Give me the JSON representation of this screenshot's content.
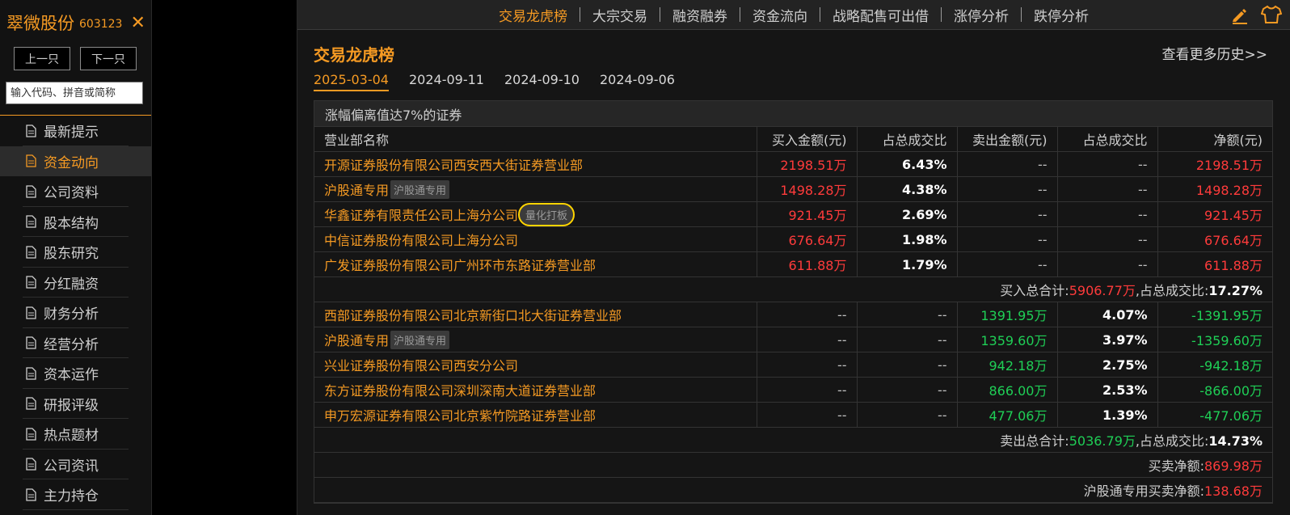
{
  "sidebar": {
    "stock_name": "翠微股份",
    "stock_code": "603123",
    "close_symbol": "✕",
    "prev_label": "上一只",
    "next_label": "下一只",
    "search_placeholder": "输入代码、拼音或简称",
    "items": [
      {
        "label": "最新提示",
        "active": false
      },
      {
        "label": "资金动向",
        "active": true
      },
      {
        "label": "公司资料",
        "active": false
      },
      {
        "label": "股本结构",
        "active": false
      },
      {
        "label": "股东研究",
        "active": false
      },
      {
        "label": "分红融资",
        "active": false
      },
      {
        "label": "财务分析",
        "active": false
      },
      {
        "label": "经营分析",
        "active": false
      },
      {
        "label": "资本运作",
        "active": false
      },
      {
        "label": "研报评级",
        "active": false
      },
      {
        "label": "热点题材",
        "active": false
      },
      {
        "label": "公司资讯",
        "active": false
      },
      {
        "label": "主力持仓",
        "active": false
      }
    ]
  },
  "topnav": {
    "tabs": [
      {
        "label": "交易龙虎榜",
        "active": true
      },
      {
        "label": "大宗交易",
        "active": false
      },
      {
        "label": "融资融券",
        "active": false
      },
      {
        "label": "资金流向",
        "active": false
      },
      {
        "label": "战略配售可出借",
        "active": false
      },
      {
        "label": "涨停分析",
        "active": false
      },
      {
        "label": "跌停分析",
        "active": false
      }
    ],
    "tools": [
      "edit-icon",
      "skin-shirt-icon"
    ]
  },
  "main": {
    "title": "交易龙虎榜",
    "more_link": "查看更多历史>>",
    "dates": [
      {
        "label": "2025-03-04",
        "active": true
      },
      {
        "label": "2024-09-11",
        "active": false
      },
      {
        "label": "2024-09-10",
        "active": false
      },
      {
        "label": "2024-09-06",
        "active": false
      }
    ]
  },
  "table": {
    "caption": "涨幅偏离值达7%的证券",
    "headers": [
      "营业部名称",
      "买入金额(元)",
      "占总成交比",
      "卖出金额(元)",
      "占总成交比",
      "净额(元)"
    ],
    "buy_rows": [
      {
        "name": "开源证券股份有限公司西安西大街证券营业部",
        "tag": "",
        "buy": "2198.51万",
        "buy_pct": "6.43%",
        "sell": "--",
        "sell_pct": "--",
        "net": "2198.51万"
      },
      {
        "name": "沪股通专用",
        "tag": "沪股通专用",
        "buy": "1498.28万",
        "buy_pct": "4.38%",
        "sell": "--",
        "sell_pct": "--",
        "net": "1498.28万"
      },
      {
        "name": "华鑫证券有限责任公司上海分公司",
        "tag": "量化打板",
        "buy": "921.45万",
        "buy_pct": "2.69%",
        "sell": "--",
        "sell_pct": "--",
        "net": "921.45万"
      },
      {
        "name": "中信证券股份有限公司上海分公司",
        "tag": "",
        "buy": "676.64万",
        "buy_pct": "1.98%",
        "sell": "--",
        "sell_pct": "--",
        "net": "676.64万"
      },
      {
        "name": "广发证券股份有限公司广州环市东路证券营业部",
        "tag": "",
        "buy": "611.88万",
        "buy_pct": "1.79%",
        "sell": "--",
        "sell_pct": "--",
        "net": "611.88万"
      }
    ],
    "buy_total": {
      "label1": "买入总合计:",
      "amount": "5906.77万",
      "label2": ",占总成交比:",
      "pct": "17.27%"
    },
    "sell_rows": [
      {
        "name": "西部证券股份有限公司北京新街口北大街证券营业部",
        "tag": "",
        "buy": "--",
        "buy_pct": "--",
        "sell": "1391.95万",
        "sell_pct": "4.07%",
        "net": "-1391.95万"
      },
      {
        "name": "沪股通专用",
        "tag": "沪股通专用",
        "buy": "--",
        "buy_pct": "--",
        "sell": "1359.60万",
        "sell_pct": "3.97%",
        "net": "-1359.60万"
      },
      {
        "name": "兴业证券股份有限公司西安分公司",
        "tag": "",
        "buy": "--",
        "buy_pct": "--",
        "sell": "942.18万",
        "sell_pct": "2.75%",
        "net": "-942.18万"
      },
      {
        "name": "东方证券股份有限公司深圳深南大道证券营业部",
        "tag": "",
        "buy": "--",
        "buy_pct": "--",
        "sell": "866.00万",
        "sell_pct": "2.53%",
        "net": "-866.00万"
      },
      {
        "name": "申万宏源证券有限公司北京紫竹院路证券营业部",
        "tag": "",
        "buy": "--",
        "buy_pct": "--",
        "sell": "477.06万",
        "sell_pct": "1.39%",
        "net": "-477.06万"
      }
    ],
    "sell_total": {
      "label1": "卖出总合计:",
      "amount": "5036.79万",
      "label2": ",占总成交比:",
      "pct": "14.73%"
    },
    "net_total": {
      "label": "买卖净额:",
      "amount": "869.98万"
    },
    "hgt_net": {
      "label": "沪股通专用买卖净额:",
      "amount": "138.68万"
    }
  },
  "colors": {
    "accent": "#f59a23",
    "up": "#ff3b3b",
    "down": "#1fcf56",
    "highlight_circle": "#ffd400"
  }
}
